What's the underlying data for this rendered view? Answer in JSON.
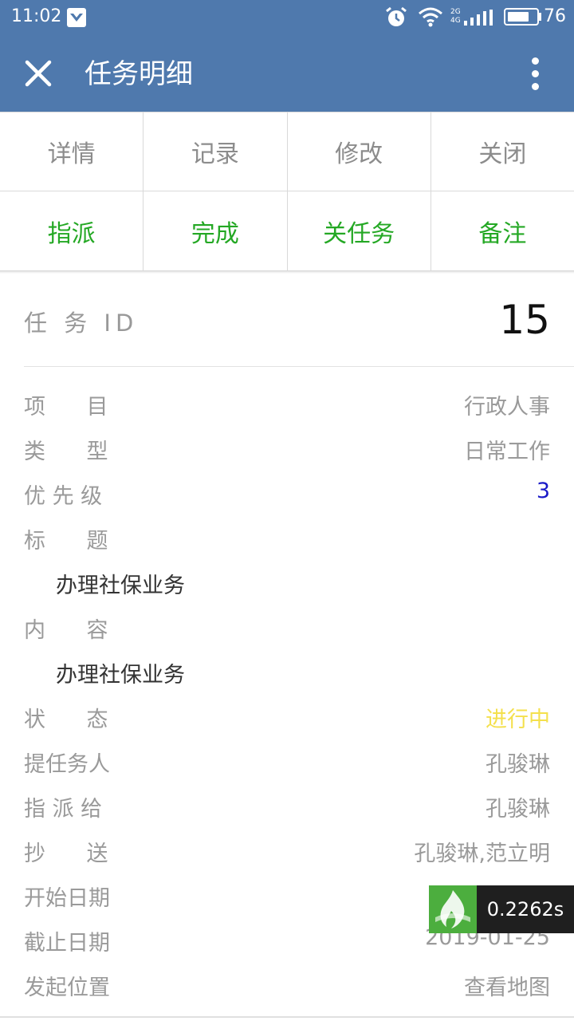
{
  "status_bar": {
    "time": "11:02",
    "network": [
      "2G",
      "4G"
    ],
    "battery": "76",
    "battery_level": 0.76
  },
  "app_bar": {
    "title": "任务明细",
    "close_icon": "close-icon",
    "more_icon": "more-vertical-icon"
  },
  "actions_row1": [
    {
      "label": "详情"
    },
    {
      "label": "记录"
    },
    {
      "label": "修改"
    },
    {
      "label": "关闭"
    }
  ],
  "actions_row2": [
    {
      "label": "指派"
    },
    {
      "label": "完成"
    },
    {
      "label": "关任务"
    },
    {
      "label": "备注"
    }
  ],
  "task": {
    "id_label": "任 务 ID",
    "id_value": "15",
    "fields": {
      "project": {
        "label": "项      目",
        "value": "行政人事"
      },
      "type": {
        "label": "类      型",
        "value": "日常工作"
      },
      "priority": {
        "label": "优 先 级",
        "value": "3"
      },
      "title": {
        "label": "标      题",
        "value": "办理社保业务"
      },
      "content": {
        "label": "内      容",
        "value": "办理社保业务"
      },
      "status": {
        "label": "状      态",
        "value": "进行中"
      },
      "creator": {
        "label": "提任务人",
        "value": "孔骏琳"
      },
      "assignee": {
        "label": "指 派 给",
        "value": "孔骏琳"
      },
      "cc": {
        "label": "抄      送",
        "value": "孔骏琳,范立明"
      },
      "start_date": {
        "label": "开始日期",
        "value": ""
      },
      "due_date": {
        "label": "截止日期",
        "value": "2019-01-25"
      },
      "location": {
        "label": "发起位置",
        "value": "查看地图"
      }
    }
  },
  "timer": {
    "value": "0.2262s"
  },
  "colors": {
    "bar_blue": "#4f79ad",
    "action_green": "#24a824",
    "status_yellow": "#f4e04d",
    "priority_blue": "#1a1ac8"
  }
}
